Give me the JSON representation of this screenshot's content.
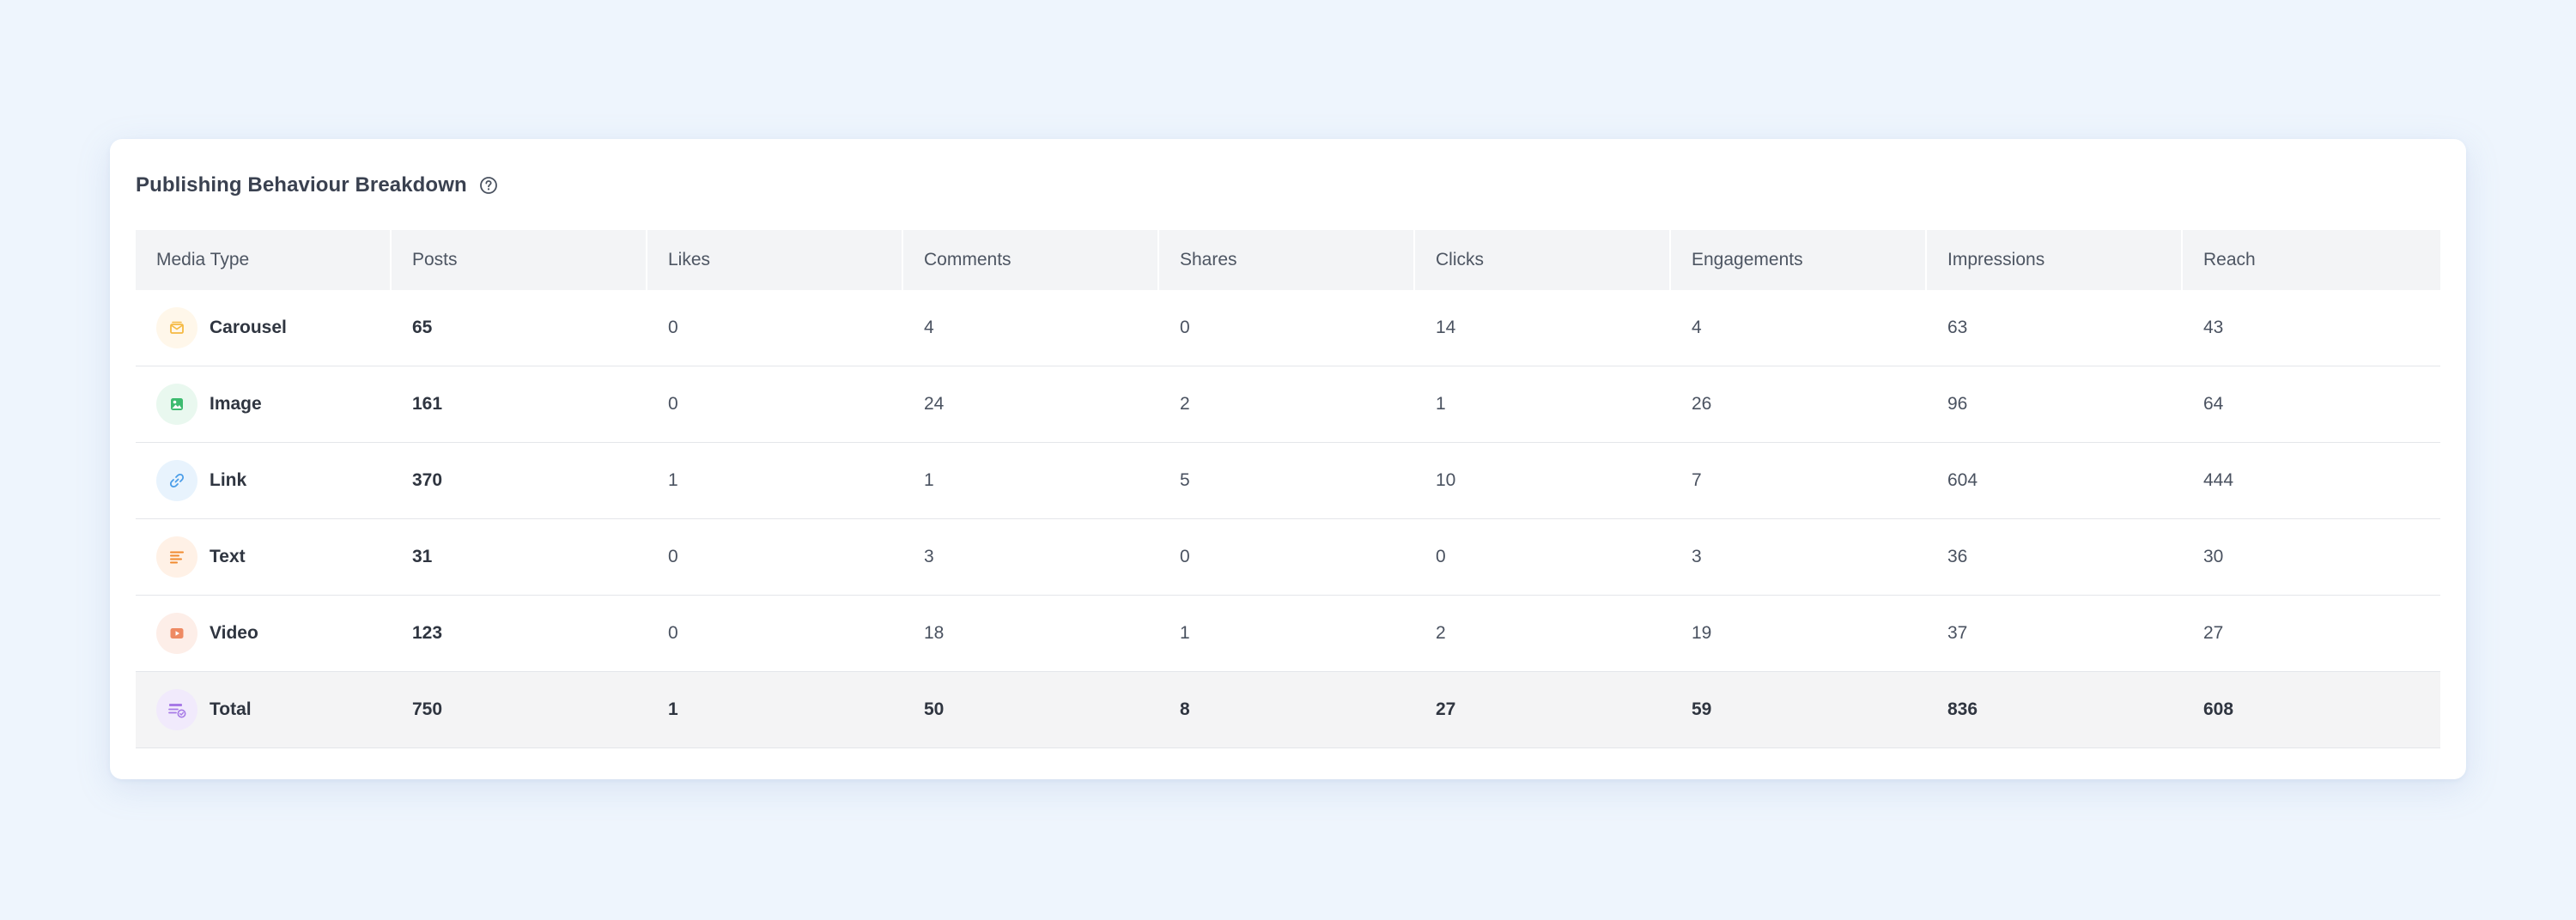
{
  "card": {
    "title": "Publishing Behaviour Breakdown"
  },
  "table": {
    "columns": [
      "Media Type",
      "Posts",
      "Likes",
      "Comments",
      "Shares",
      "Clicks",
      "Engagements",
      "Impressions",
      "Reach"
    ],
    "rows": [
      {
        "media": "Carousel",
        "icon": "carousel-icon",
        "icon_bg": "#fff7ea",
        "icon_color": "#f5b942",
        "values": [
          "65",
          "0",
          "4",
          "0",
          "14",
          "4",
          "63",
          "43"
        ]
      },
      {
        "media": "Image",
        "icon": "image-icon",
        "icon_bg": "#e9f8ef",
        "icon_color": "#3dbb6f",
        "values": [
          "161",
          "0",
          "24",
          "2",
          "1",
          "26",
          "96",
          "64"
        ]
      },
      {
        "media": "Link",
        "icon": "link-icon",
        "icon_bg": "#e8f3fd",
        "icon_color": "#4a9de8",
        "values": [
          "370",
          "1",
          "1",
          "5",
          "10",
          "7",
          "604",
          "444"
        ]
      },
      {
        "media": "Text",
        "icon": "text-icon",
        "icon_bg": "#fff1e6",
        "icon_color": "#f08a2f",
        "values": [
          "31",
          "0",
          "3",
          "0",
          "0",
          "3",
          "36",
          "30"
        ]
      },
      {
        "media": "Video",
        "icon": "video-icon",
        "icon_bg": "#fdeee8",
        "icon_color": "#ee8a63",
        "values": [
          "123",
          "0",
          "18",
          "1",
          "2",
          "19",
          "37",
          "27"
        ]
      }
    ],
    "total": {
      "media": "Total",
      "icon": "total-icon",
      "icon_bg": "#f1eafc",
      "icon_color": "#a77ae6",
      "values": [
        "750",
        "1",
        "50",
        "8",
        "27",
        "59",
        "836",
        "608"
      ]
    }
  }
}
